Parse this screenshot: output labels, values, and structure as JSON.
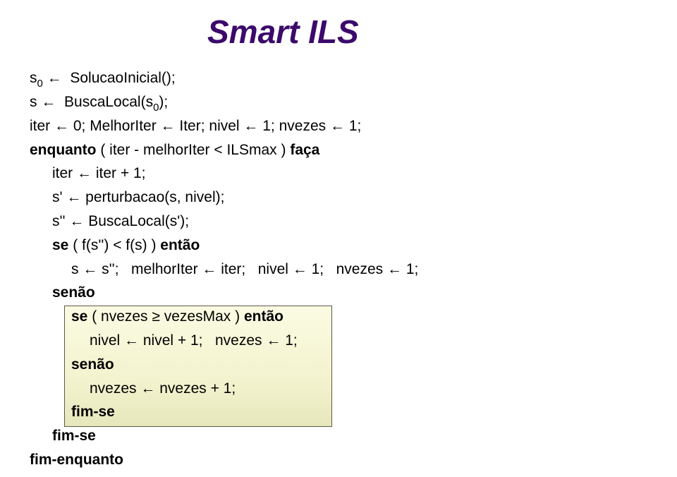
{
  "title": "Smart ILS",
  "code": {
    "l1": {
      "a": "s",
      "sub": "0",
      "b": " ←  SolucaoInicial();"
    },
    "l2": {
      "a": "s ←  BuscaLocal(s",
      "sub": "0",
      "b": ");"
    },
    "l3": "iter ← 0; MelhorIter ← Iter; nivel ← 1; nvezes ← 1;",
    "l4": {
      "kw1": "enquanto",
      "mid": " ( iter - melhorIter < ILSmax ) ",
      "kw2": "faça"
    },
    "l5": "iter ← iter + 1;",
    "l6": "s' ← perturbacao(s, nivel);",
    "l7": "s'' ← BuscaLocal(s');",
    "l8": {
      "kw1": "se",
      "mid": " ( f(s'') < f(s) ) ",
      "kw2": "então"
    },
    "l9": "s ← s'';   melhorIter ← iter;   nivel ← 1;   nvezes ← 1;",
    "l10": "senão",
    "box": {
      "l1": {
        "kw1": "se",
        "mid": " ( nvezes ≥ vezesMax ) ",
        "kw2": "então"
      },
      "l2": "nivel ← nivel + 1;   nvezes ← 1;",
      "l3": "senão",
      "l4": "nvezes ← nvezes + 1;",
      "l5": "fim-se"
    },
    "l11": "fim-se",
    "l12": "fim-enquanto"
  },
  "colors": {
    "title": "#3b0a6b",
    "box_fill": "#f3f3cf",
    "box_border": "#5a5a4a"
  }
}
